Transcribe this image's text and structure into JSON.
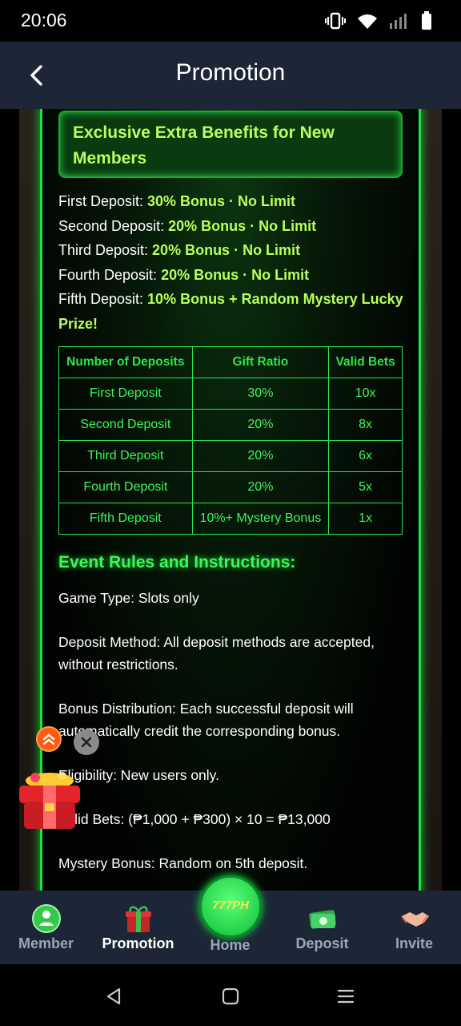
{
  "status_bar": {
    "time": "20:06"
  },
  "header": {
    "title": "Promotion"
  },
  "benefits": {
    "title": "Exclusive Extra Benefits for New Members",
    "lines": [
      {
        "label": "First Deposit: ",
        "value": "30% Bonus · No Limit"
      },
      {
        "label": "Second Deposit: ",
        "value": "20% Bonus · No Limit"
      },
      {
        "label": "Third Deposit: ",
        "value": "20% Bonus · No Limit"
      },
      {
        "label": "Fourth Deposit: ",
        "value": "20% Bonus · No Limit"
      },
      {
        "label": "Fifth Deposit: ",
        "value": "10% Bonus + Random Mystery Lucky Prize!"
      }
    ]
  },
  "table": {
    "headers": [
      "Number of Deposits",
      "Gift Ratio",
      "Valid Bets"
    ],
    "rows": [
      [
        "First Deposit",
        "30%",
        "10x"
      ],
      [
        "Second Deposit",
        "20%",
        "8x"
      ],
      [
        "Third Deposit",
        "20%",
        "6x"
      ],
      [
        "Fourth Deposit",
        "20%",
        "5x"
      ],
      [
        "Fifth Deposit",
        "10%+ Mystery Bonus",
        "1x"
      ]
    ]
  },
  "rules": {
    "title": "Event Rules and Instructions:",
    "items": [
      "Game Type: Slots only",
      "Deposit Method: All deposit methods are accepted, without restrictions.",
      "Bonus Distribution: Each successful deposit will automatically credit the corresponding bonus.",
      "Eligibility: New users only.",
      "Valid Bets: (₱1,000 + ₱300) × 10 = ₱13,000",
      "Mystery Bonus: Random on 5th deposit."
    ]
  },
  "bottom_nav": {
    "items": [
      {
        "label": "Member"
      },
      {
        "label": "Promotion"
      },
      {
        "label": "Home"
      },
      {
        "label": "Deposit"
      },
      {
        "label": "Invite"
      }
    ],
    "home_logo": "777PH"
  },
  "colors": {
    "accent": "#2be64a",
    "highlight": "#b8ff5a",
    "header_bg": "#1c2636"
  }
}
